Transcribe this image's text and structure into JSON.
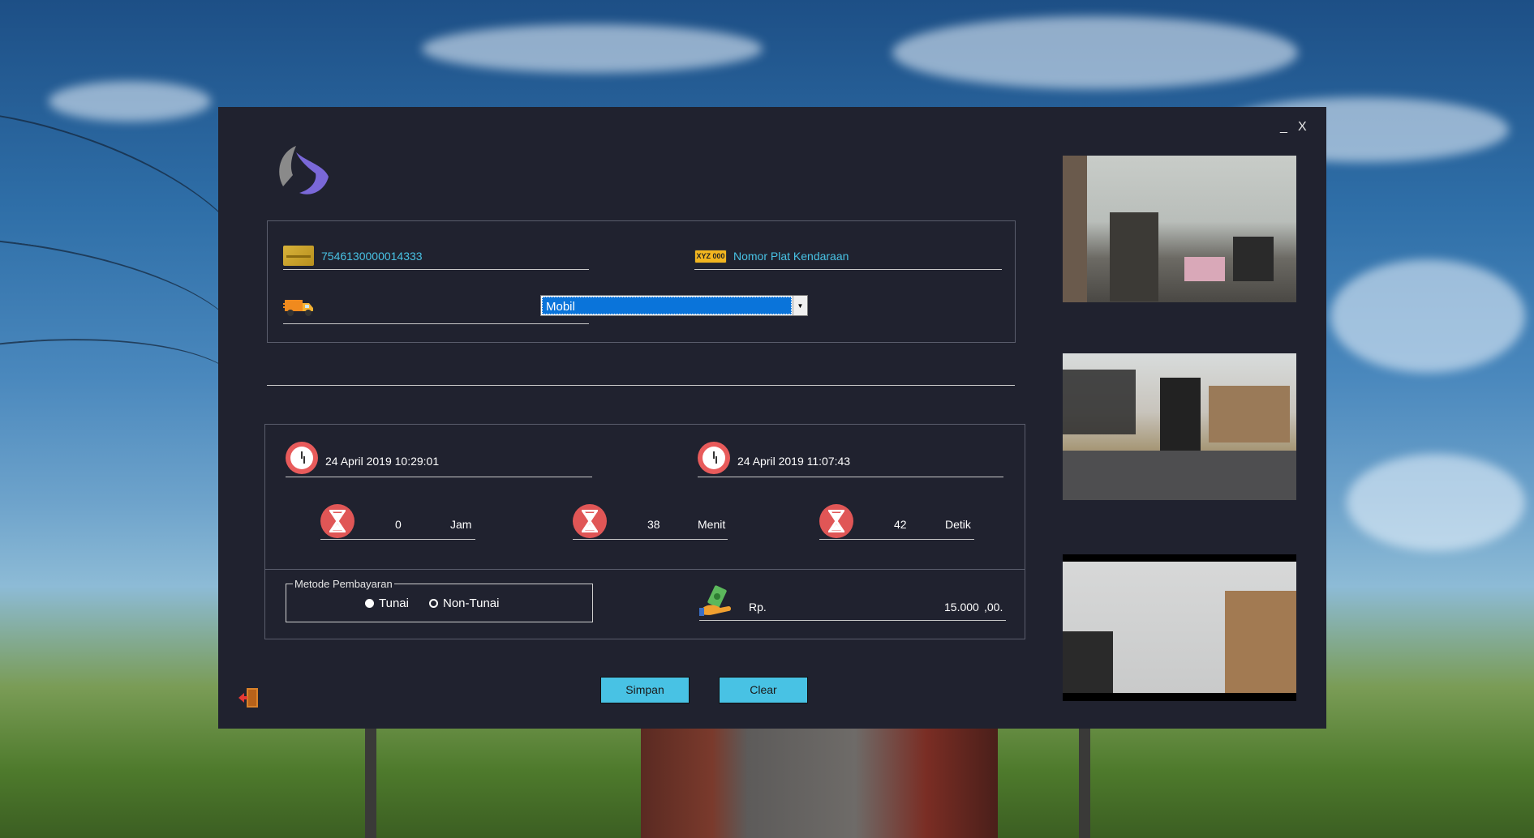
{
  "window": {
    "minimize_label": "_",
    "close_label": "X"
  },
  "card": {
    "icon": "credit-card-icon",
    "number": "7546130000014333"
  },
  "plate": {
    "icon": "license-plate-icon",
    "plate_icon_text": "XYZ 000",
    "placeholder": "Nomor Plat Kendaraan"
  },
  "vehicle": {
    "icon": "truck-icon",
    "selected": "Mobil"
  },
  "entry_time": {
    "icon": "clock-icon",
    "value": "24 April 2019 10:29:01"
  },
  "exit_time": {
    "icon": "clock-icon",
    "value": "24 April 2019 11:07:43"
  },
  "duration": {
    "hours": {
      "value": "0",
      "unit": "Jam"
    },
    "minutes": {
      "value": "38",
      "unit": "Menit"
    },
    "seconds": {
      "value": "42",
      "unit": "Detik"
    }
  },
  "payment": {
    "legend": "Metode Pembayaran",
    "options": [
      {
        "label": "Tunai",
        "selected": true
      },
      {
        "label": "Non-Tunai",
        "selected": false
      }
    ]
  },
  "price": {
    "icon": "money-hand-icon",
    "prefix": "Rp.",
    "amount": "15.000",
    "suffix": ",00."
  },
  "buttons": {
    "save": "Simpan",
    "clear": "Clear"
  },
  "exit_icon": "exit-door-icon",
  "colors": {
    "window_bg": "#20222f",
    "accent": "#48c2e4",
    "select_highlight": "#0a74da",
    "icon_red": "#e05656"
  }
}
